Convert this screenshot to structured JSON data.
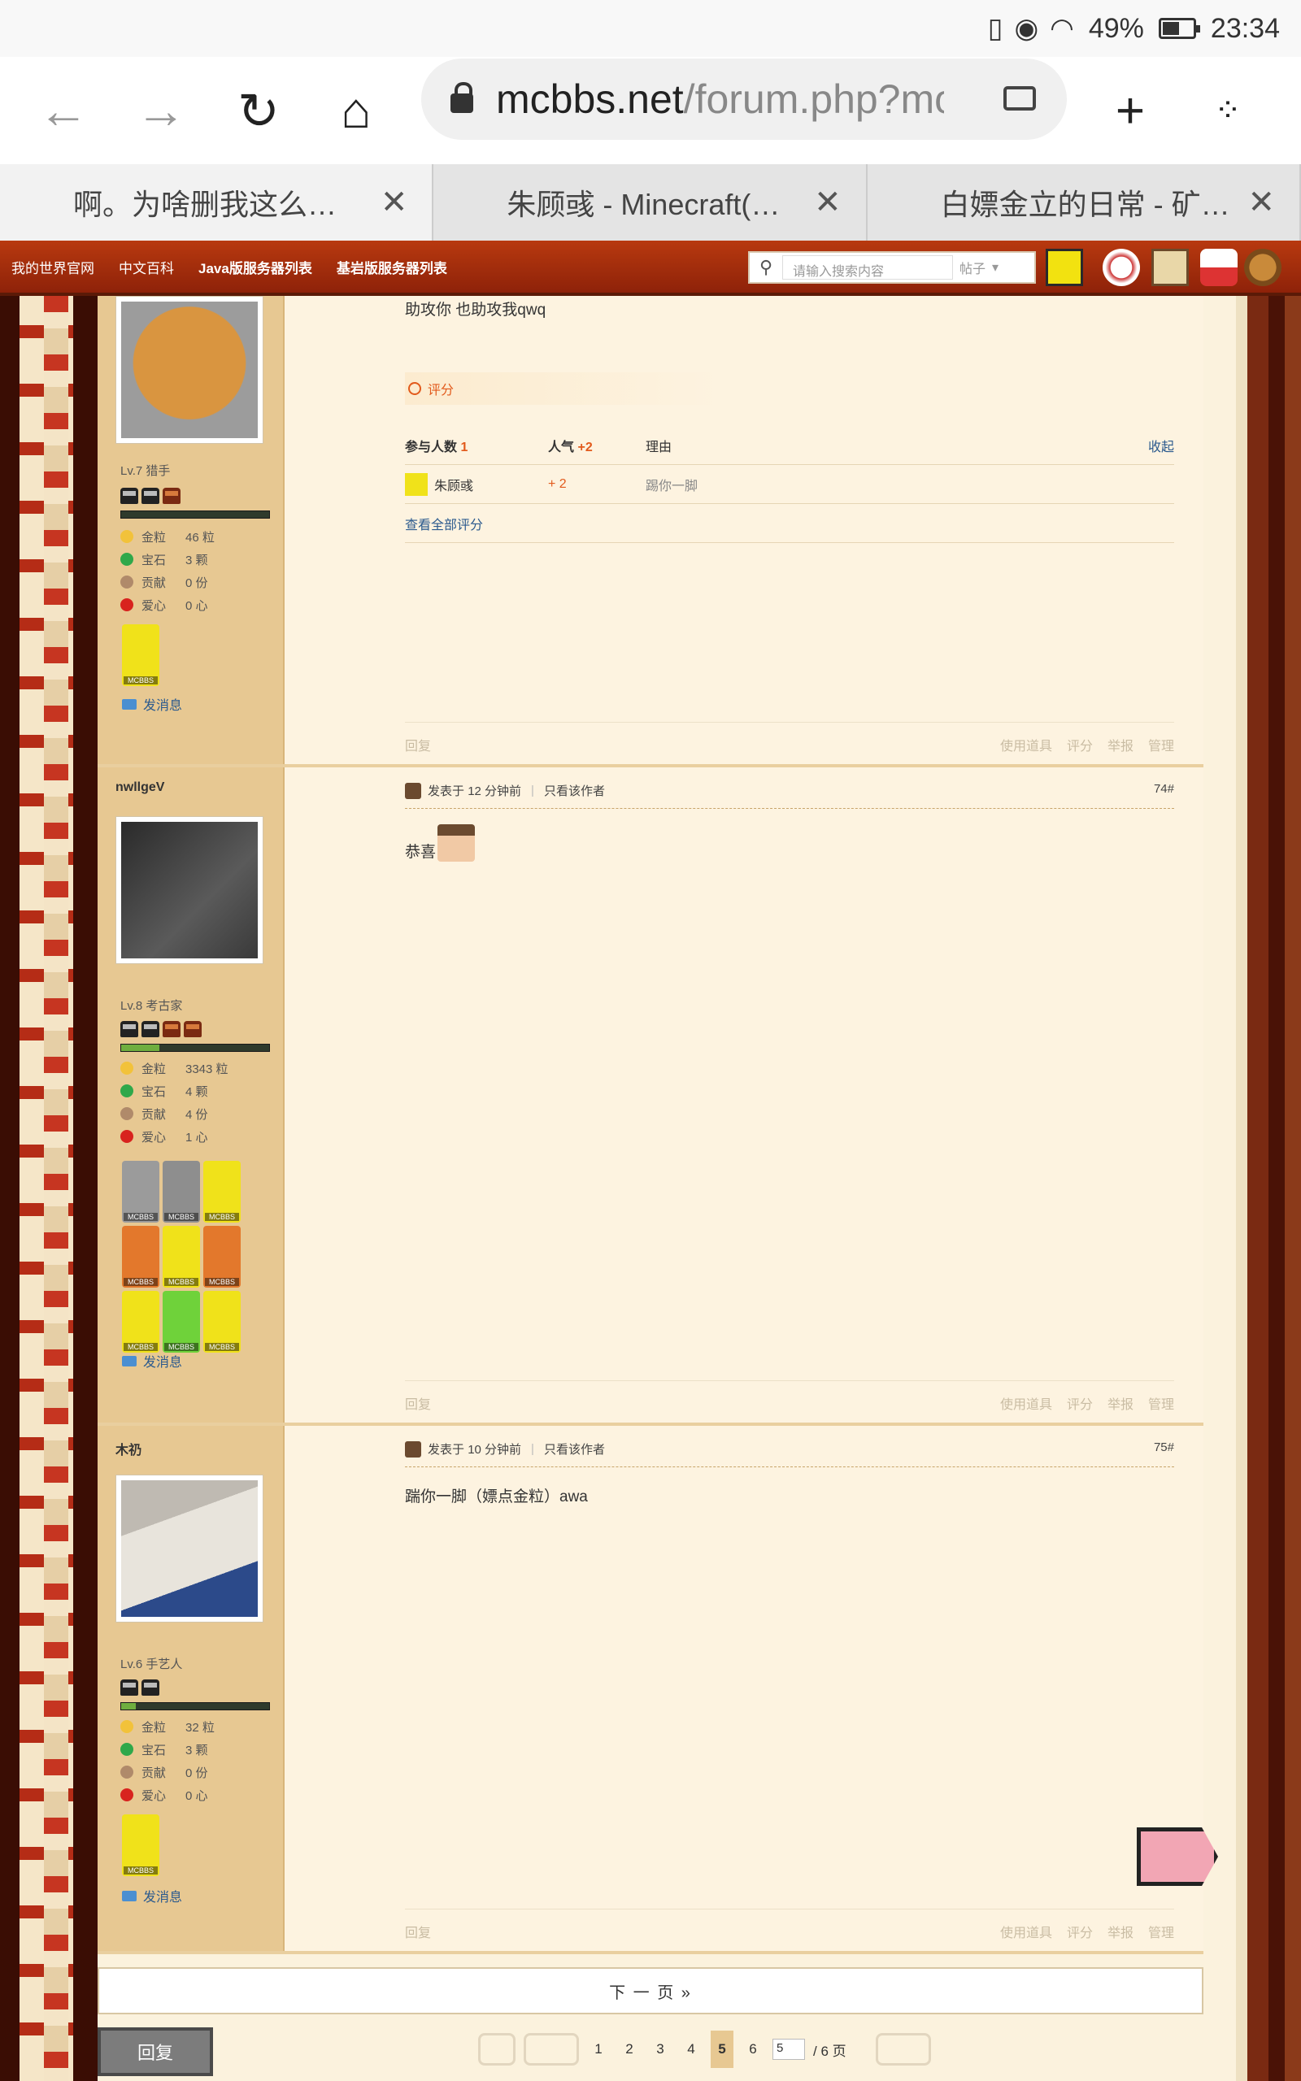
{
  "status_bar": {
    "battery": "49%",
    "battery_level": 0.49,
    "time": "23:34"
  },
  "browser": {
    "url_host": "mcbbs.net",
    "url_path": "/forum.php?mod",
    "tabs": [
      {
        "title": "啊。为啥删我这么…",
        "active": true
      },
      {
        "title": "朱顾彧 - Minecraft(…",
        "active": false
      },
      {
        "title": "白嫖金立的日常 - 矿…",
        "active": false
      }
    ]
  },
  "site_header": {
    "nav": [
      "我的世界官网",
      "中文百科",
      "Java版服务器列表",
      "基岩版服务器列表"
    ],
    "search_placeholder": "请输入搜索内容",
    "search_scope": "帖子"
  },
  "labels": {
    "gold": "金粒",
    "gem": "宝石",
    "contrib": "贡献",
    "love": "爱心",
    "send_msg": "发消息",
    "reply": "回复",
    "use_item": "使用道具",
    "rate": "评分",
    "report": "举报",
    "manage": "管理",
    "posted_prefix": "发表于",
    "only_author": "只看该作者",
    "medal_text": "MCBBS"
  },
  "posts": [
    {
      "level": "Lv.7 猎手",
      "gold": "46 粒",
      "gem": "3 颗",
      "contrib": "0 份",
      "love": "0 心",
      "text": "助攻你 也助攻我qwq",
      "rating": {
        "title": "评分",
        "col_people": "参与人数",
        "people_count": "1",
        "col_pop": "人气",
        "pop_total": "+2",
        "col_reason": "理由",
        "collapse": "收起",
        "rows": [
          {
            "user": "朱顾彧",
            "pop": "+ 2",
            "reason": "踢你一脚"
          }
        ],
        "view_all": "查看全部评分"
      }
    },
    {
      "username": "nwllgeV",
      "level": "Lv.8 考古家",
      "gold": "3343 粒",
      "gem": "4 颗",
      "contrib": "4 份",
      "love": "1 心",
      "time": "12 分钟前",
      "floor": "74#",
      "text": "恭喜"
    },
    {
      "username": "木礽",
      "level": "Lv.6 手艺人",
      "gold": "32 粒",
      "gem": "3 颗",
      "contrib": "0 份",
      "love": "0 心",
      "time": "10 分钟前",
      "floor": "75#",
      "text": "踹你一脚（嫖点金粒）awa"
    }
  ],
  "pagination": {
    "next_page": "下 一 页 »",
    "reply_button": "回复",
    "pages": [
      "1",
      "2",
      "3",
      "4",
      "5",
      "6"
    ],
    "current": "5",
    "input_value": "5",
    "total": "/ 6 页"
  }
}
